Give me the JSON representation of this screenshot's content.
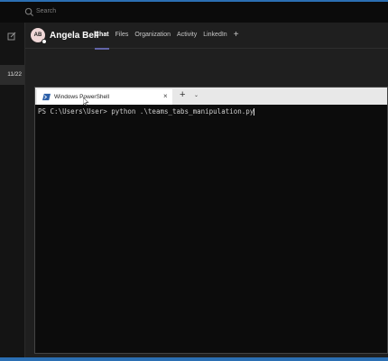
{
  "search": {
    "placeholder": "Search"
  },
  "sidebar": {
    "date": "11/22"
  },
  "chat_header": {
    "avatar_initials": "AB",
    "user_name": "Angela Bell",
    "tabs": [
      {
        "label": "Chat",
        "active": true
      },
      {
        "label": "Files"
      },
      {
        "label": "Organization"
      },
      {
        "label": "Activity"
      },
      {
        "label": "LinkedIn"
      }
    ],
    "add_tab": "+"
  },
  "powershell": {
    "tab_title": "Windows PowerShell",
    "close": "×",
    "new_tab": "+",
    "dropdown": "⌄",
    "prompt": "PS C:\\Users\\User> ",
    "command": "python .\\teams_tabs_manipulation.py"
  },
  "colors": {
    "accent": "#2b6fb3",
    "active_tab_underline": "#6264a7",
    "terminal_bg": "#0c0c0c"
  }
}
